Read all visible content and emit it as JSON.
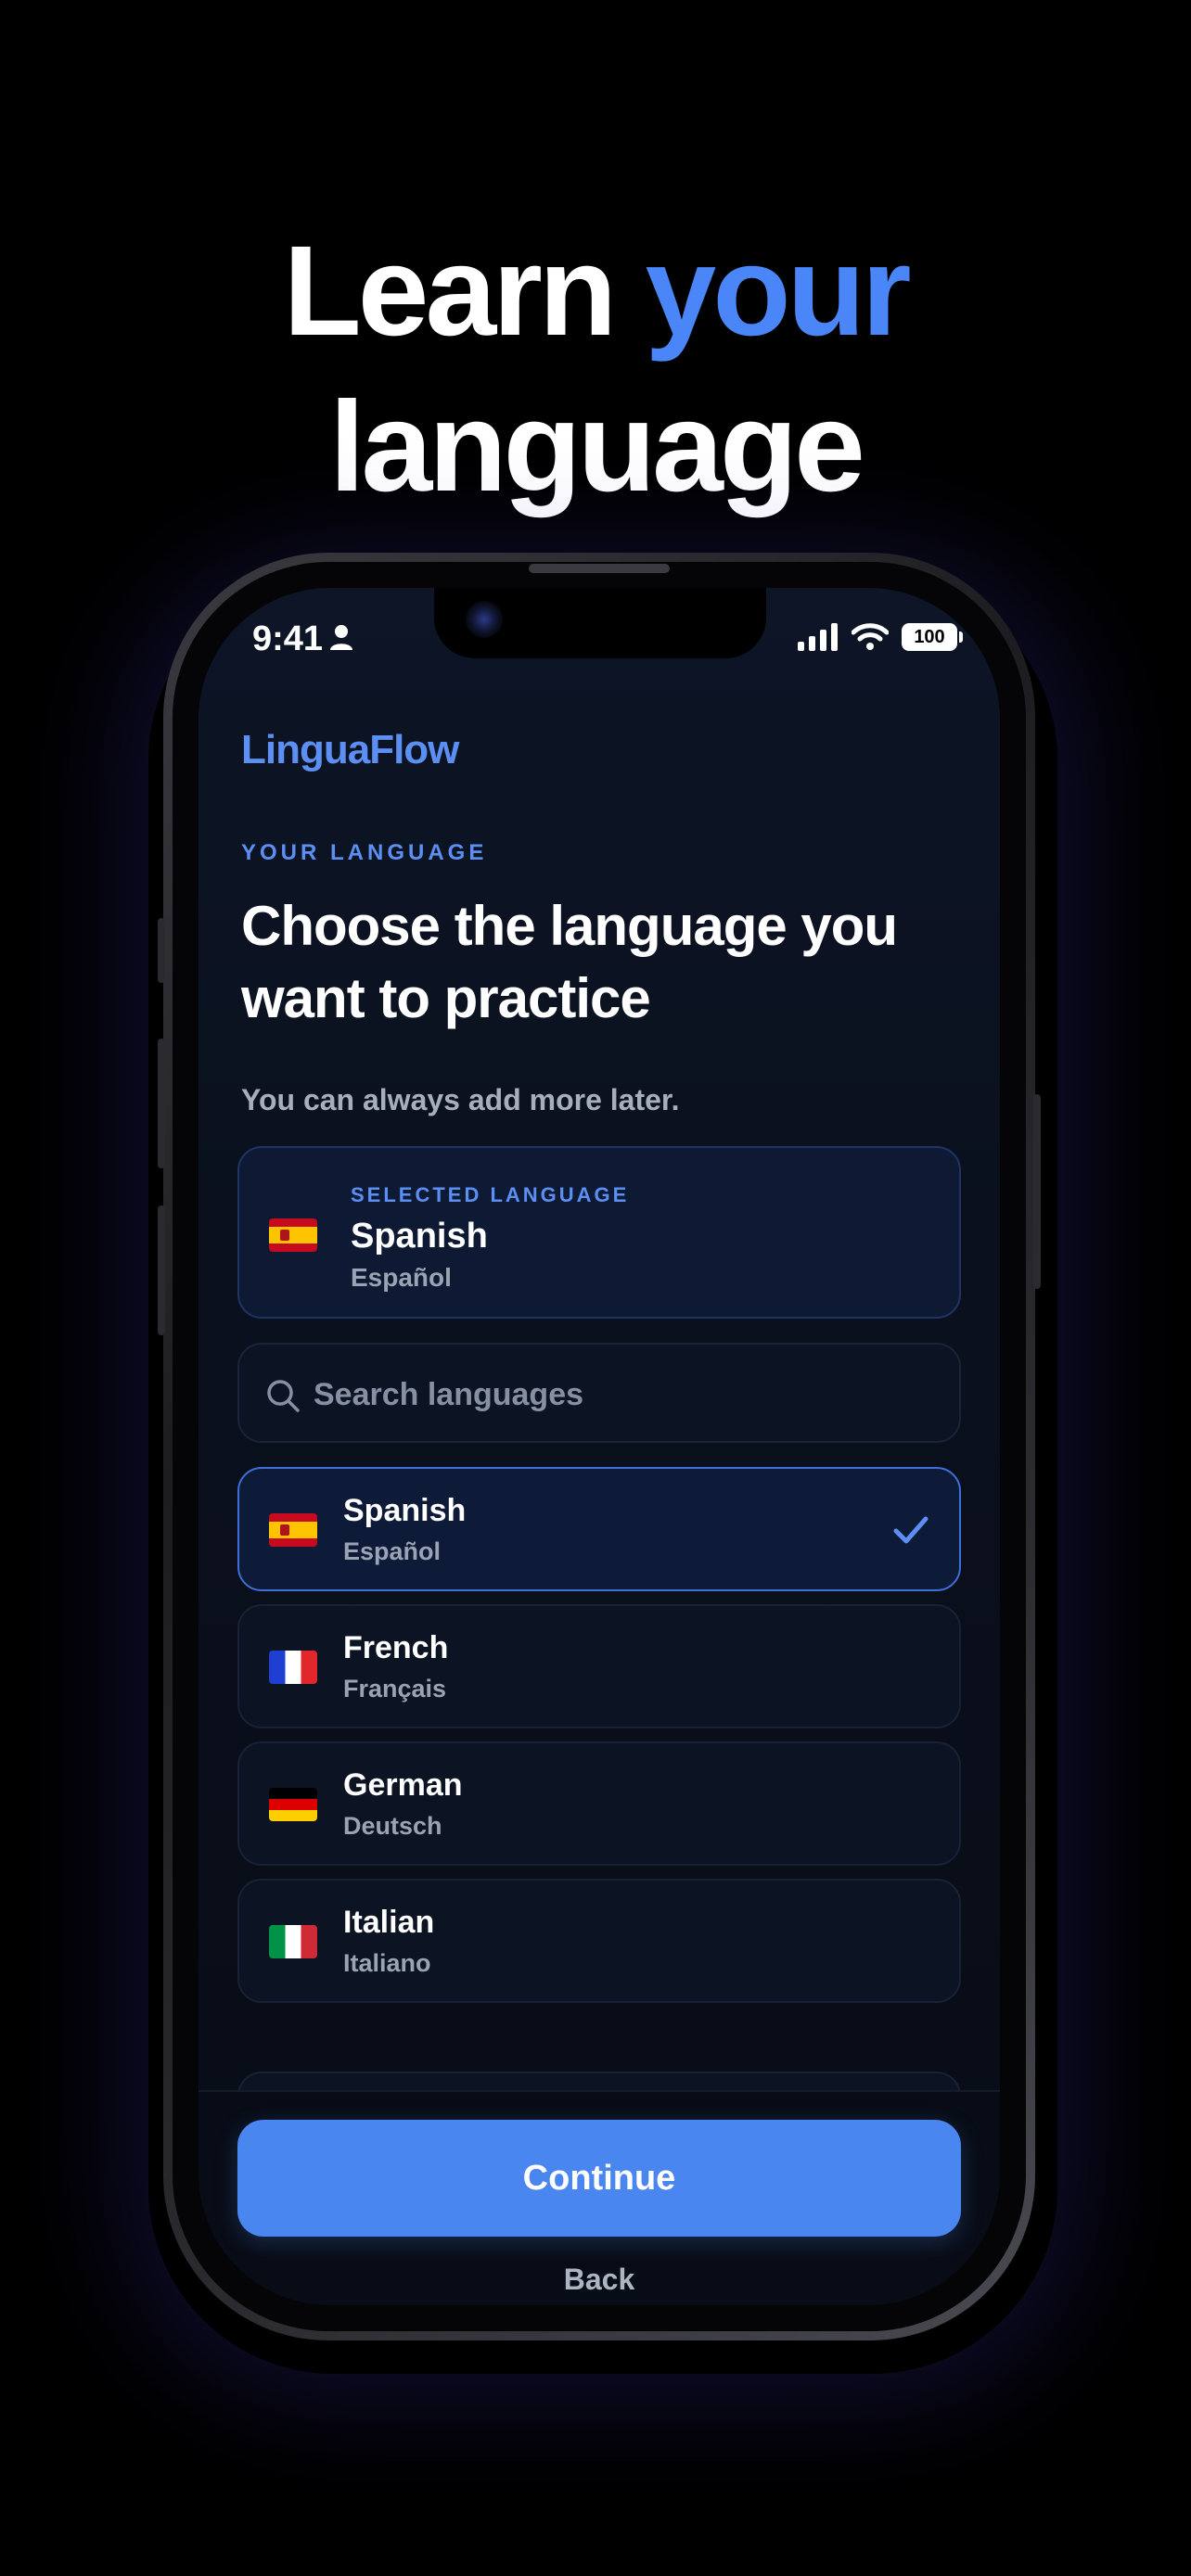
{
  "headline": {
    "part1": "Learn ",
    "accent": "your",
    "line2": "language",
    "accent_color": "#4a86f7"
  },
  "status_bar": {
    "time": "9:41",
    "battery": "100"
  },
  "app": {
    "brand": "LinguaFlow",
    "eyebrow": "YOUR LANGUAGE",
    "title": "Choose the language you want to practice",
    "subtitle": "You can always add more later."
  },
  "selected": {
    "label": "SELECTED LANGUAGE",
    "name": "Spanish",
    "native": "Español",
    "flag": "spain-flag-icon"
  },
  "search": {
    "placeholder": "Search languages",
    "value": ""
  },
  "languages": [
    {
      "name": "Spanish",
      "native": "Español",
      "flag": "spain-flag-icon",
      "selected": true
    },
    {
      "name": "French",
      "native": "Français",
      "flag": "france-flag-icon",
      "selected": false
    },
    {
      "name": "German",
      "native": "Deutsch",
      "flag": "germany-flag-icon",
      "selected": false
    },
    {
      "name": "Italian",
      "native": "Italiano",
      "flag": "italy-flag-icon",
      "selected": false
    }
  ],
  "actions": {
    "continue": "Continue",
    "back": "Back",
    "primary_color": "#4a86f0"
  }
}
